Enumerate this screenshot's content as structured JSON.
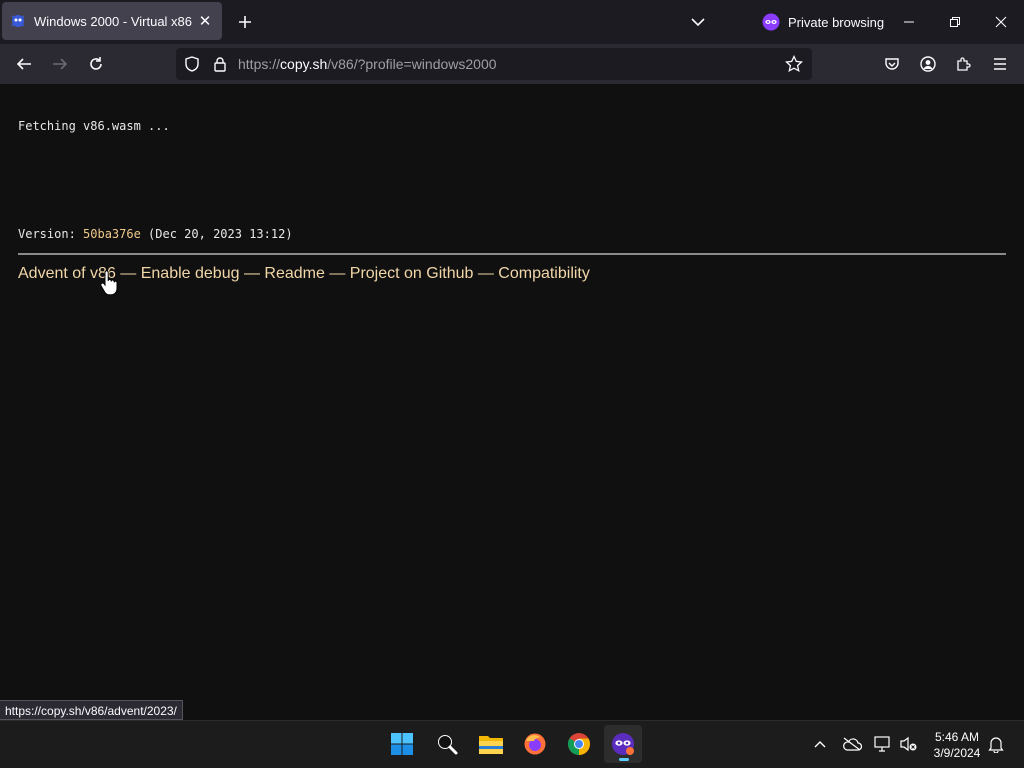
{
  "browser": {
    "tab": {
      "title": "Windows 2000 - Virtual x86"
    },
    "private_label": "Private browsing",
    "url": {
      "scheme": "https://",
      "host": "copy.sh",
      "path": "/v86/?profile=windows2000"
    }
  },
  "page": {
    "status": "Fetching v86.wasm ...",
    "version_prefix": "Version: ",
    "version_hash": "50ba376e",
    "version_date": " (Dec 20, 2023 13:12)",
    "links": [
      {
        "label": "Advent of v86"
      },
      {
        "label": "Enable debug"
      },
      {
        "label": "Readme"
      },
      {
        "label": "Project on Github"
      },
      {
        "label": "Compatibility"
      }
    ],
    "separator": " — "
  },
  "link_status": "https://copy.sh/v86/advent/2023/",
  "taskbar": {
    "apps": [
      "windows-start-icon",
      "search-icon",
      "file-explorer-icon",
      "firefox-icon",
      "chrome-icon",
      "firefox-private-icon"
    ],
    "time": "5:46 AM",
    "date": "3/9/2024"
  },
  "colors": {
    "page_bg": "#101010",
    "link": "#f1d6a8",
    "version_hash": "#f0c98a",
    "private_purple": "#8b3dff"
  }
}
